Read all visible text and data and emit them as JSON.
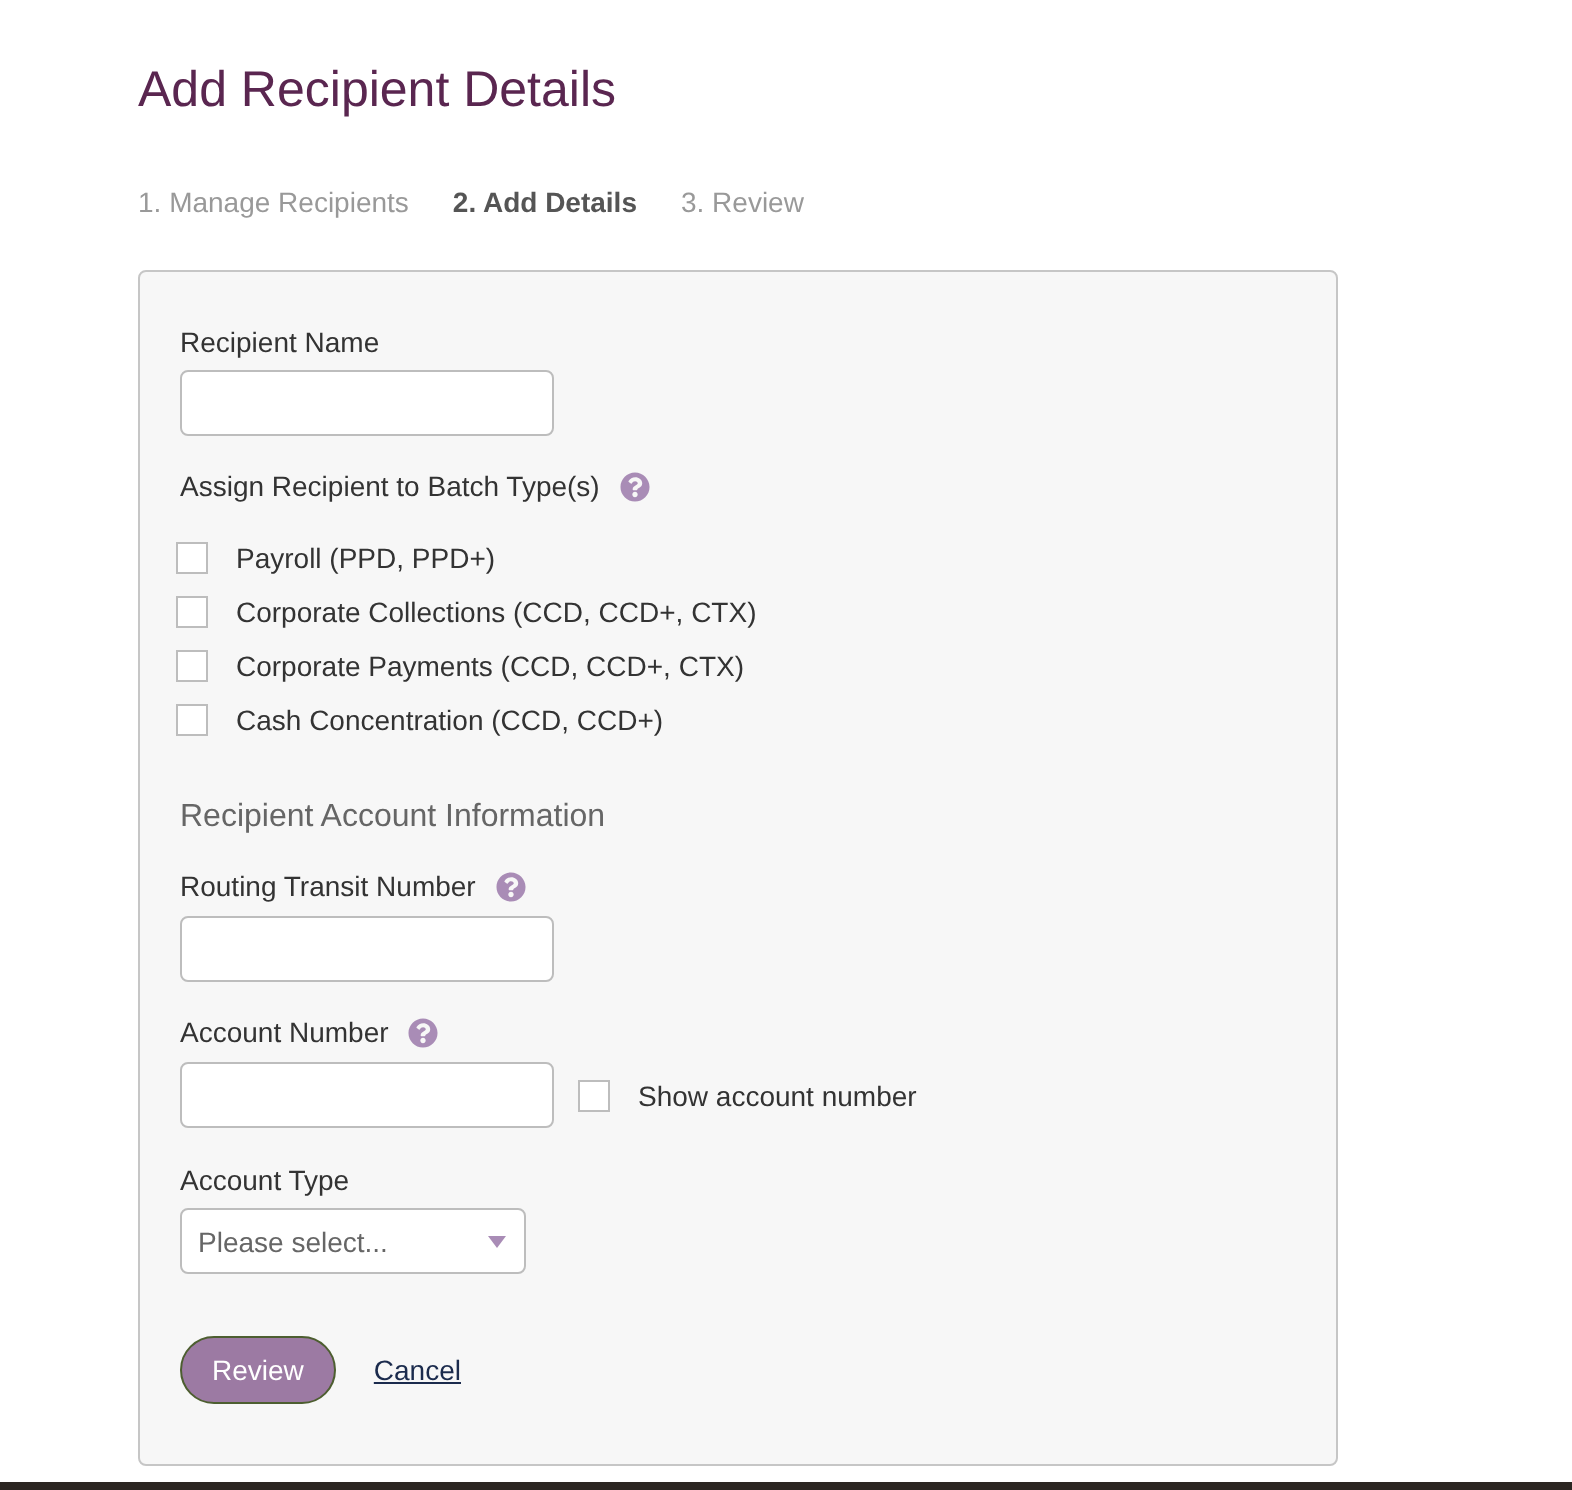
{
  "page": {
    "title": "Add Recipient Details"
  },
  "steps": [
    {
      "label": "1. Manage Recipients",
      "selected": false
    },
    {
      "label": "2. Add Details",
      "selected": true
    },
    {
      "label": "3. Review",
      "selected": false
    }
  ],
  "form": {
    "recipient_name": {
      "label": "Recipient Name"
    },
    "batch_types": {
      "label": "Assign Recipient to Batch Type(s)",
      "help": true,
      "options": [
        {
          "label": "Payroll (PPD, PPD+)",
          "checked": false
        },
        {
          "label": "Corporate Collections (CCD, CCD+, CTX)",
          "checked": false
        },
        {
          "label": "Corporate Payments (CCD, CCD+, CTX)",
          "checked": false
        },
        {
          "label": "Cash Concentration (CCD, CCD+)",
          "checked": false
        }
      ]
    },
    "account_heading": "Recipient Account Information",
    "routing_number": {
      "label": "Routing Transit Number",
      "help": true
    },
    "account_number": {
      "label": "Account Number",
      "help": true,
      "show_toggle": {
        "label": "Show account number",
        "checked": false
      }
    },
    "account_type": {
      "label": "Account Type",
      "placeholder": "Please select..."
    },
    "actions": [
      {
        "kind": "primary",
        "label": "Review"
      },
      {
        "kind": "link",
        "label": "Cancel"
      }
    ]
  }
}
